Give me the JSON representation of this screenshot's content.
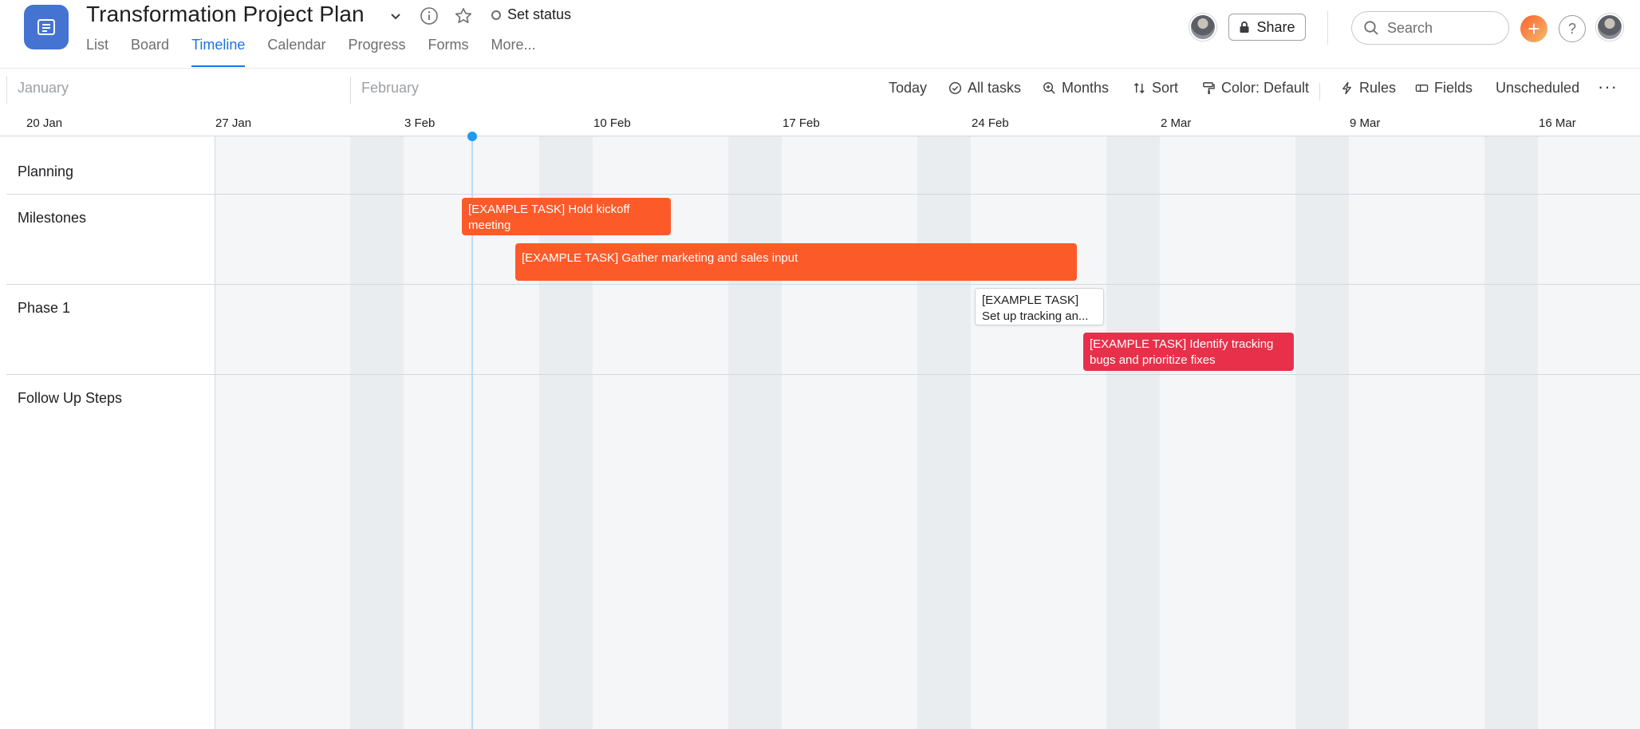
{
  "project": {
    "title": "Transformation Project Plan",
    "set_status_label": "Set status"
  },
  "tabs": [
    {
      "label": "List"
    },
    {
      "label": "Board"
    },
    {
      "label": "Timeline"
    },
    {
      "label": "Calendar"
    },
    {
      "label": "Progress"
    },
    {
      "label": "Forms"
    },
    {
      "label": "More..."
    }
  ],
  "header": {
    "share_label": "Share",
    "search_placeholder": "Search",
    "help_label": "?",
    "plus_label": "+"
  },
  "toolbar": {
    "months": [
      "January",
      "February"
    ],
    "today_label": "Today",
    "all_tasks_label": "All tasks",
    "months_label": "Months",
    "sort_label": "Sort",
    "color_label": "Color: Default",
    "rules_label": "Rules",
    "fields_label": "Fields",
    "unscheduled_label": "Unscheduled",
    "more_label": "···"
  },
  "dates": [
    "20 Jan",
    "27 Jan",
    "3 Feb",
    "10 Feb",
    "17 Feb",
    "24 Feb",
    "2 Mar",
    "9 Mar",
    "16 Mar"
  ],
  "sections": [
    {
      "label": "Planning"
    },
    {
      "label": "Milestones"
    },
    {
      "label": "Phase 1"
    },
    {
      "label": "Follow Up Steps"
    }
  ],
  "tasks": [
    {
      "label": "[EXAMPLE TASK] Hold kickoff meeting",
      "color": "#fd5a2a"
    },
    {
      "label": "[EXAMPLE TASK] Gather marketing and sales input",
      "color": "#fd5a2a"
    },
    {
      "label_line1": "[EXAMPLE TASK]",
      "label_line2": "Set up tracking an...",
      "color": "#ffffff"
    },
    {
      "label": "[EXAMPLE TASK] Identify tracking bugs and prioritize fixes",
      "color": "#e8304a"
    }
  ],
  "colors": {
    "accent": "#1a73e8",
    "app_icon": "#4573d2",
    "today_marker": "#1e9bf0"
  }
}
